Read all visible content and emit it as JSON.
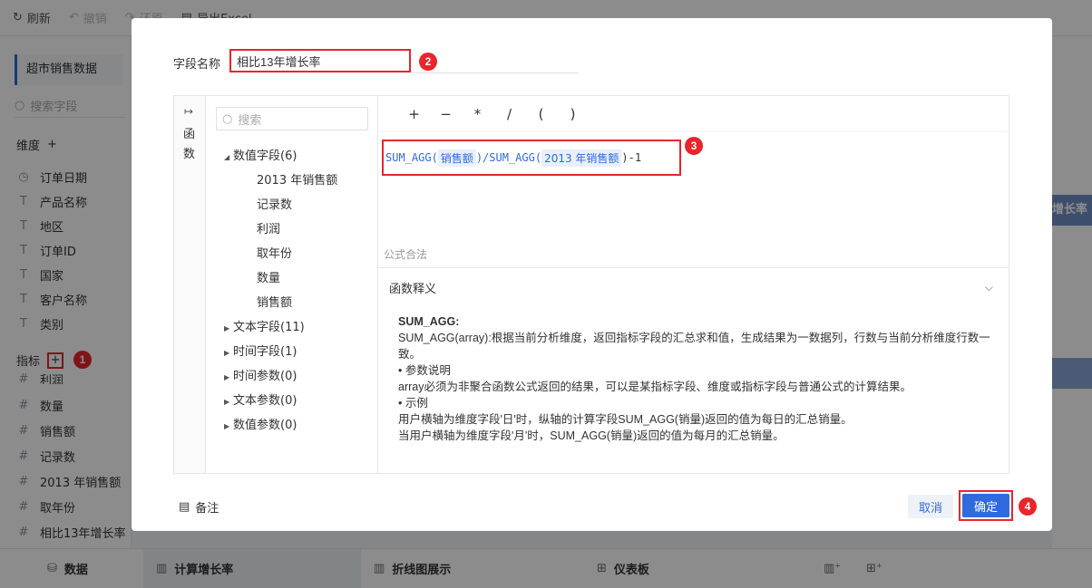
{
  "toolbar": {
    "refresh_label": "刷新",
    "undo_label": "撤销",
    "redo_label": "还原",
    "export_label": "导出Excel"
  },
  "left_panel": {
    "dataset_name": "超市销售数据",
    "search_placeholder": "搜索字段",
    "dimension_title": "维度",
    "dimensions": [
      {
        "icon": "clock",
        "label": "订单日期"
      },
      {
        "icon": "text",
        "label": "产品名称"
      },
      {
        "icon": "text",
        "label": "地区"
      },
      {
        "icon": "text",
        "label": "订单ID"
      },
      {
        "icon": "text",
        "label": "国家"
      },
      {
        "icon": "text",
        "label": "客户名称"
      },
      {
        "icon": "text",
        "label": "类别"
      }
    ],
    "measure_title": "指标",
    "measures": [
      {
        "icon": "number",
        "label": "利润"
      },
      {
        "icon": "number",
        "label": "数量"
      },
      {
        "icon": "number",
        "label": "销售额"
      },
      {
        "icon": "number-calc",
        "label": "记录数"
      },
      {
        "icon": "number-calc",
        "label": "2013 年销售额"
      },
      {
        "icon": "number-calc",
        "label": "取年份"
      },
      {
        "icon": "number-calc",
        "label": "相比13年增长率"
      }
    ]
  },
  "right_bg": {
    "highlight_text": "增长率"
  },
  "bottom_tabs": [
    {
      "label": "数据"
    },
    {
      "label": "计算增长率"
    },
    {
      "label": "折线图展示"
    },
    {
      "label": "仪表板"
    }
  ],
  "dialog": {
    "field_name_label": "字段名称",
    "field_name_value": "相比13年增长率",
    "func_strip_text": "函数",
    "tree_search_placeholder": "搜索",
    "tree": {
      "numeric_group": "数值字段(6)",
      "numeric_fields": [
        "2013 年销售额",
        "记录数",
        "利润",
        "取年份",
        "数量",
        "销售额"
      ],
      "other_groups": [
        "文本字段(11)",
        "时间字段(1)",
        "时间参数(0)",
        "文本参数(0)",
        "数值参数(0)"
      ]
    },
    "operators": [
      "+",
      "−",
      "*",
      "/",
      "(",
      ")"
    ],
    "formula": {
      "func1": "SUM_AGG(",
      "field1": "销售额",
      "mid": ")/SUM_AGG(",
      "field2": "2013 年销售额",
      "tail": ")-1"
    },
    "valid_text": "公式合法",
    "doc_header": "函数释义",
    "doc": {
      "title": "SUM_AGG:",
      "lines": [
        "SUM_AGG(array):根据当前分析维度，返回指标字段的汇总求和值，生成结果为一数据列，行数与当前分析维度行数一致。",
        "• 参数说明",
        "array必须为非聚合函数公式返回的结果，可以是某指标字段、维度或指标字段与普通公式的计算结果。",
        "• 示例",
        "用户横轴为维度字段'日'时，纵轴的计算字段SUM_AGG(销量)返回的值为每日的汇总销量。",
        "当用户横轴为维度字段'月'时，SUM_AGG(销量)返回的值为每月的汇总销量。"
      ]
    },
    "note_label": "备注",
    "cancel_label": "取消",
    "ok_label": "确定"
  },
  "markers": [
    "1",
    "2",
    "3",
    "4"
  ],
  "colors": {
    "accent": "#2f6bde",
    "marker_red": "#e8252b"
  }
}
